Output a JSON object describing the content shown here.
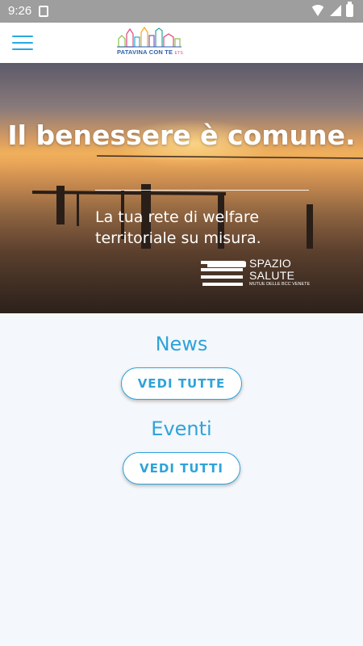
{
  "status_bar": {
    "time": "9:26",
    "icons": [
      "sim-card-icon",
      "wifi-icon",
      "cellular-signal-icon",
      "battery-icon"
    ]
  },
  "app_bar": {
    "menu_icon": "hamburger-menu-icon",
    "logo_text": "PATAVINA CON TE",
    "logo_suffix": "ETS",
    "accent_color": "#29a9e1"
  },
  "hero": {
    "title": "Il benessere è comune.",
    "subtitle": "La tua rete di welfare territoriale su misura.",
    "brand": {
      "name_line1": "SPAZIO",
      "name_line2": "SALUTE",
      "tagline": "MUTUE DELLE BCC VENETE"
    }
  },
  "sections": {
    "news": {
      "title": "News",
      "button_label": "VEDI TUTTE"
    },
    "eventi": {
      "title": "Eventi",
      "button_label": "VEDI TUTTI"
    }
  },
  "colors": {
    "primary": "#2ea3d9",
    "background": "#f4f7fb",
    "status_bar": "#9e9e9e"
  }
}
